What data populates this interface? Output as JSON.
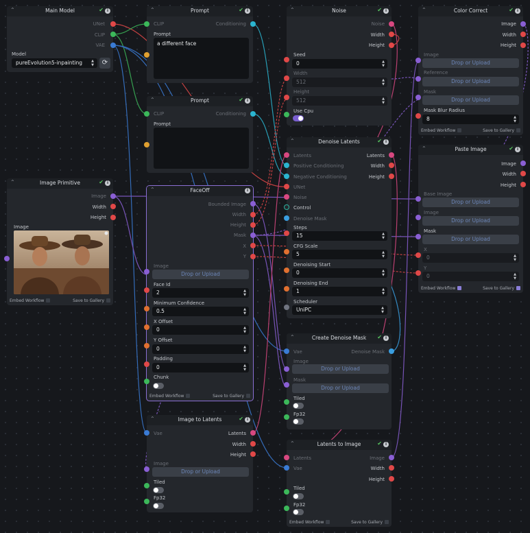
{
  "colors": {
    "unet": "#e04848",
    "clip": "#3cb85a",
    "vae": "#3a7bd5",
    "conditioning": "#2bb5d0",
    "image": "#8a5fd4",
    "integer": "#e04848",
    "float": "#e07030",
    "boolean": "#3cb85a",
    "latents": "#d84880",
    "denoise_mask": "#3a9ee0",
    "string": "#e0a030",
    "enum": "#707480",
    "control": "#2bb5a0"
  },
  "nodes": {
    "main_model": {
      "title": "Main Model",
      "out_unet": "UNet",
      "out_clip": "CLIP",
      "out_vae": "VAE",
      "model_label": "Model",
      "model_value": "pureEvolution5-inpainting"
    },
    "prompt1": {
      "title": "Prompt",
      "in_clip": "CLIP",
      "out_cond": "Conditioning",
      "prompt_label": "Prompt",
      "prompt_value": "a different face"
    },
    "prompt2": {
      "title": "Prompt",
      "in_clip": "CLIP",
      "out_cond": "Conditioning",
      "prompt_label": "Prompt",
      "prompt_value": ""
    },
    "noise": {
      "title": "Noise",
      "out_noise": "Noise",
      "out_width": "Width",
      "out_height": "Height",
      "seed_label": "Seed",
      "seed_value": "0",
      "width_label": "Width",
      "width_value": "512",
      "height_label": "Height",
      "height_value": "512",
      "usecpu_label": "Use Cpu"
    },
    "color_correct": {
      "title": "Color Correct",
      "out_image": "Image",
      "out_width": "Width",
      "out_height": "Height",
      "image_label": "Image",
      "reference_label": "Reference",
      "mask_label": "Mask",
      "drop": "Drop or Upload",
      "blur_label": "Mask Blur Radius",
      "blur_value": "8",
      "embed": "Embed Workflow",
      "save": "Save to Gallery"
    },
    "image_primitive": {
      "title": "Image Primitive",
      "out_image": "Image",
      "out_width": "Width",
      "out_height": "Height",
      "image_label": "Image",
      "embed": "Embed Workflow",
      "save": "Save to Gallery"
    },
    "faceoff": {
      "title": "FaceOff",
      "out_bounded": "Bounded Image",
      "out_width": "Width",
      "out_height": "Height",
      "out_mask": "Mask",
      "out_x": "X",
      "out_y": "Y",
      "image_label": "Image",
      "drop": "Drop or Upload",
      "faceid_label": "Face Id",
      "faceid_value": "2",
      "minconf_label": "Minimum Confidence",
      "minconf_value": "0.5",
      "xoff_label": "X Offset",
      "xoff_value": "0",
      "yoff_label": "Y Offset",
      "yoff_value": "0",
      "padding_label": "Padding",
      "padding_value": "0",
      "chunk_label": "Chunk",
      "embed": "Embed Workflow",
      "save": "Save to Gallery"
    },
    "denoise_latents": {
      "title": "Denoise Latents",
      "in_latents": "Latents",
      "in_pos": "Positive Conditioning",
      "in_neg": "Negative Conditioning",
      "in_unet": "UNet",
      "in_noise": "Noise",
      "in_control": "Control",
      "in_mask": "Denoise Mask",
      "out_latents": "Latents",
      "out_width": "Width",
      "out_height": "Height",
      "steps_label": "Steps",
      "steps_value": "15",
      "cfg_label": "CFG Scale",
      "cfg_value": "5",
      "dstart_label": "Denoising Start",
      "dstart_value": "0",
      "dend_label": "Denoising End",
      "dend_value": "1",
      "sched_label": "Scheduler",
      "sched_value": "UniPC"
    },
    "paste_image": {
      "title": "Paste Image",
      "out_image": "Image",
      "out_width": "Width",
      "out_height": "Height",
      "base_label": "Base Image",
      "image_label": "Image",
      "mask_label": "Mask",
      "drop": "Drop or Upload",
      "x_label": "X",
      "x_value": "0",
      "y_label": "Y",
      "y_value": "0",
      "embed": "Embed Workflow",
      "save": "Save to Gallery"
    },
    "create_mask": {
      "title": "Create Denoise Mask",
      "in_vae": "Vae",
      "out_mask": "Denoise Mask",
      "image_label": "Image",
      "mask_label": "Mask",
      "drop": "Drop or Upload",
      "tiled_label": "Tiled",
      "fp32_label": "Fp32"
    },
    "image_to_latents": {
      "title": "Image to Latents",
      "in_vae": "Vae",
      "out_latents": "Latents",
      "out_width": "Width",
      "out_height": "Height",
      "image_label": "Image",
      "drop": "Drop or Upload",
      "tiled_label": "Tiled",
      "fp32_label": "Fp32"
    },
    "latents_to_image": {
      "title": "Latents to Image",
      "in_latents": "Latents",
      "in_vae": "Vae",
      "out_image": "Image",
      "out_width": "Width",
      "out_height": "Height",
      "tiled_label": "Tiled",
      "fp32_label": "Fp32",
      "embed": "Embed Workflow",
      "save": "Save to Gallery"
    }
  }
}
